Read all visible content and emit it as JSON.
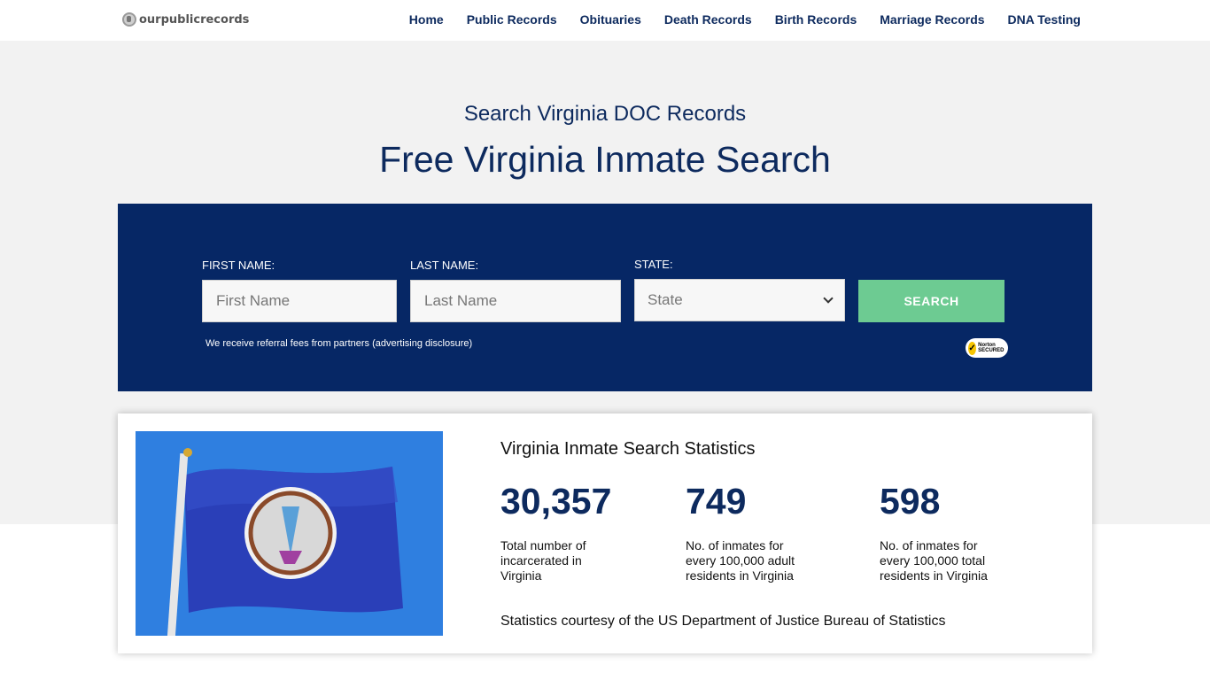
{
  "header": {
    "logo_text": "ourpublicrecords",
    "nav": [
      "Home",
      "Public Records",
      "Obituaries",
      "Death Records",
      "Birth Records",
      "Marriage Records",
      "DNA Testing"
    ]
  },
  "hero": {
    "subtitle": "Search Virginia DOC Records",
    "title": "Free Virginia Inmate Search"
  },
  "search": {
    "first_name_label": "FIRST NAME:",
    "first_name_placeholder": "First Name",
    "last_name_label": "LAST NAME:",
    "last_name_placeholder": "Last Name",
    "state_label": "STATE:",
    "state_value": "State",
    "button_label": "SEARCH",
    "disclosure": "We receive referral fees from partners (advertising disclosure)",
    "badge_text": "Norton SECURED"
  },
  "stats": {
    "heading": "Virginia Inmate Search Statistics",
    "items": [
      {
        "value": "30,357",
        "label": "Total number of incarcerated in Virginia"
      },
      {
        "value": "749",
        "label": "No. of inmates for every 100,000 adult residents in Virginia"
      },
      {
        "value": "598",
        "label": "No. of inmates for every 100,000 total residents in Virginia"
      }
    ],
    "credit": "Statistics courtesy of the US Department of Justice Bureau of Statistics"
  },
  "colors": {
    "navy": "#062765",
    "heading_blue": "#0d2a5e",
    "search_green": "#6dcb92",
    "hero_bg": "#f2f2f2"
  }
}
